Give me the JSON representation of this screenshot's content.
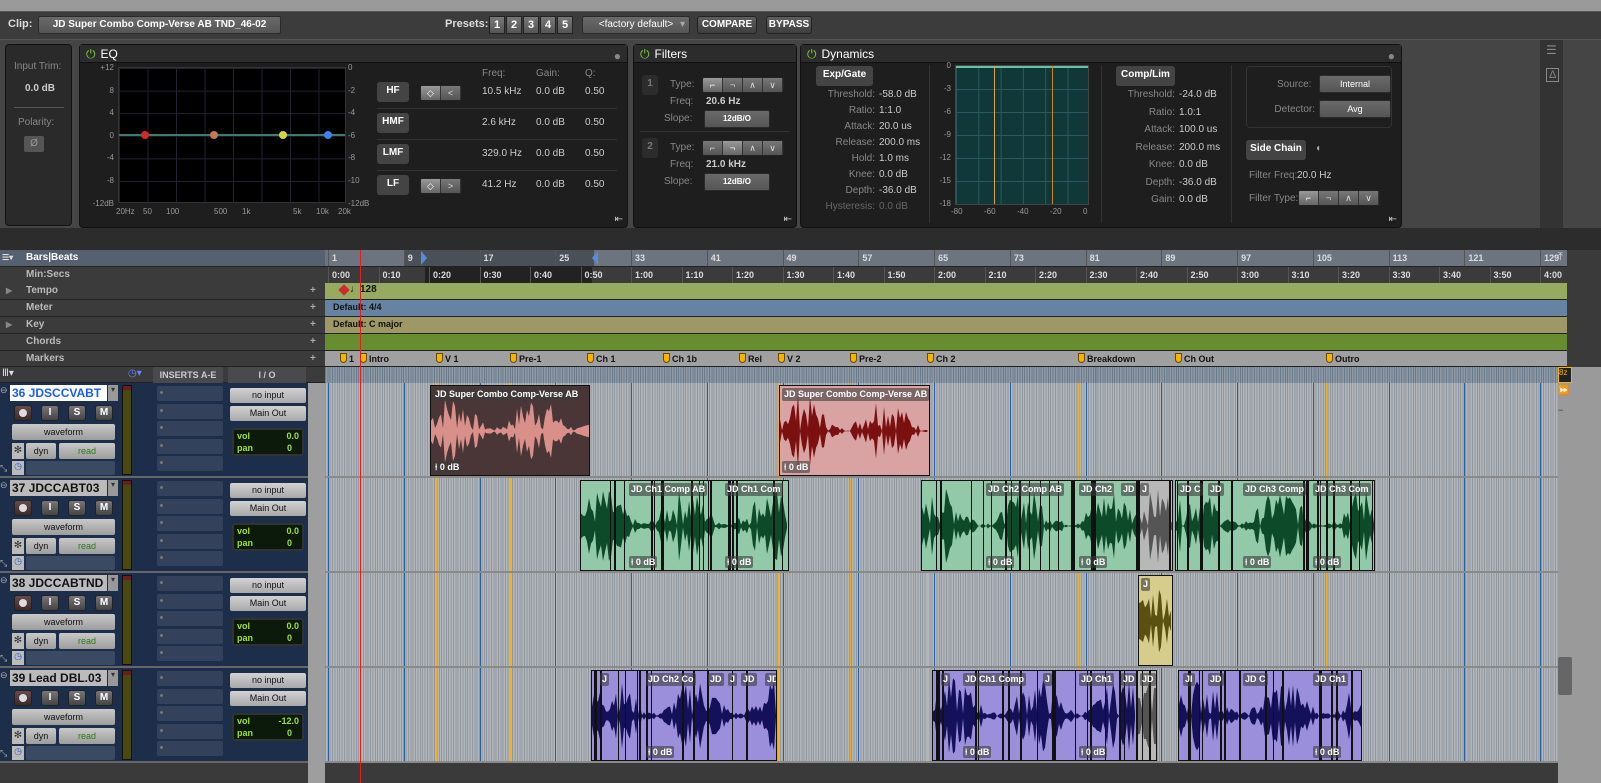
{
  "header": {
    "clip_label": "Clip:",
    "clip_name": "JD Super Combo Comp-Verse AB TND_46-02",
    "presets_label": "Presets:",
    "presets": [
      "1",
      "2",
      "3",
      "4",
      "5"
    ],
    "preset_dropdown": "<factory default>",
    "compare": "COMPARE",
    "bypass": "BYPASS"
  },
  "input": {
    "trim_label": "Input Trim:",
    "trim_value": "0.0 dB",
    "polarity_label": "Polarity:",
    "polarity_symbol": "Ø"
  },
  "eq": {
    "title": "EQ",
    "left_axis": [
      "+12",
      "8",
      "4",
      "0",
      "-4",
      "-8",
      "-12dB"
    ],
    "right_axis": [
      "0",
      "-2",
      "-4",
      "-6",
      "-8",
      "-10",
      "-12dB"
    ],
    "freq_axis": [
      "20Hz",
      "50",
      "100",
      "500",
      "1k",
      "5k",
      "10k",
      "20k"
    ],
    "col_headers": [
      "Freq:",
      "Gain:",
      "Q:"
    ],
    "bands": [
      {
        "name": "HF",
        "freq": "10.5 kHz",
        "gain": "0.0 dB",
        "q": "0.50",
        "color": "#3b82f6"
      },
      {
        "name": "HMF",
        "freq": "2.6 kHz",
        "gain": "0.0 dB",
        "q": "0.50",
        "color": "#d4d43a"
      },
      {
        "name": "LMF",
        "freq": "329.0 Hz",
        "gain": "0.0 dB",
        "q": "0.50",
        "color": "#c07a5a"
      },
      {
        "name": "LF",
        "freq": "41.2 Hz",
        "gain": "0.0 dB",
        "q": "0.50",
        "color": "#d02a2a"
      }
    ]
  },
  "filters": {
    "title": "Filters",
    "type_label": "Type:",
    "freq_label": "Freq:",
    "slope_label": "Slope:",
    "items": [
      {
        "num": "1",
        "freq": "20.6 Hz",
        "slope": "12dB/O"
      },
      {
        "num": "2",
        "freq": "21.0 kHz",
        "slope": "12dB/O"
      }
    ]
  },
  "dynamics": {
    "title": "Dynamics",
    "gate": {
      "title": "Exp/Gate",
      "rows": [
        [
          "Threshold:",
          "-58.0 dB"
        ],
        [
          "Ratio:",
          "1:1.0"
        ],
        [
          "Attack:",
          "20.0 us"
        ],
        [
          "Release:",
          "200.0 ms"
        ],
        [
          "Hold:",
          "1.0 ms"
        ],
        [
          "Knee:",
          "0.0 dB"
        ],
        [
          "Depth:",
          "-36.0 dB"
        ],
        [
          "Hysteresis:",
          "0.0 dB"
        ]
      ]
    },
    "graph": {
      "y_axis": [
        "0",
        "-3",
        "-6",
        "-9",
        "-12",
        "-15",
        "-18"
      ],
      "x_axis": [
        "-80",
        "-60",
        "-40",
        "-20",
        "0"
      ]
    },
    "comp": {
      "title": "Comp/Lim",
      "rows": [
        [
          "Threshold:",
          "-24.0 dB"
        ],
        [
          "Ratio:",
          "1.0:1"
        ],
        [
          "Attack:",
          "100.0 us"
        ],
        [
          "Release:",
          "200.0 ms"
        ],
        [
          "Knee:",
          "0.0 dB"
        ],
        [
          "Depth:",
          "-36.0 dB"
        ],
        [
          "Gain:",
          "0.0 dB"
        ]
      ]
    },
    "source_label": "Source:",
    "source_value": "Internal",
    "detector_label": "Detector:",
    "detector_value": "Avg",
    "side_chain": "Side Chain",
    "filter_freq_label": "Filter Freq:",
    "filter_freq_value": "20.0 Hz",
    "filter_type_label": "Filter Type:"
  },
  "rulers": {
    "bars_label": "Bars|Beats",
    "minsecs_label": "Min:Secs",
    "tempo_label": "Tempo",
    "meter_label": "Meter",
    "key_label": "Key",
    "chords_label": "Chords",
    "markers_label": "Markers",
    "bars": [
      "1",
      "9",
      "17",
      "25",
      "33",
      "41",
      "49",
      "57",
      "65",
      "73",
      "81",
      "89",
      "97",
      "105",
      "113",
      "121",
      "129"
    ],
    "times": [
      "0:00",
      "0:10",
      "0:20",
      "0:30",
      "0:40",
      "0:50",
      "1:00",
      "1:10",
      "1:20",
      "1:30",
      "1:40",
      "1:50",
      "2:00",
      "2:10",
      "2:20",
      "2:30",
      "2:40",
      "2:50",
      "3:00",
      "3:10",
      "3:20",
      "3:30",
      "3:40",
      "3:50",
      "4:00"
    ],
    "tempo_value": "128",
    "meter_value": "Default: 4/4",
    "key_value": "Default: C major",
    "markers": [
      "1",
      "Intro",
      "V 1",
      "Pre-1",
      "Ch 1",
      "Ch 1b",
      "Rel",
      "V 2",
      "Pre-2",
      "Ch 2",
      "Breakdown",
      "Ch Out",
      "Outro"
    ]
  },
  "track_header": {
    "inserts": "INSERTS A-E",
    "io": "I / O"
  },
  "tracks": [
    {
      "name": "36 JDSCCVABT",
      "input": "no input",
      "output": "Main Out",
      "view": "waveform",
      "dyn": "dyn",
      "auto": "read",
      "vol": "0.0",
      "pan": "0"
    },
    {
      "name": "37 JDCCABT03",
      "input": "no input",
      "output": "Main Out",
      "view": "waveform",
      "dyn": "dyn",
      "auto": "read",
      "vol": "0.0",
      "pan": "0"
    },
    {
      "name": "38 JDCCABTND",
      "input": "no input",
      "output": "Main Out",
      "view": "waveform",
      "dyn": "dyn",
      "auto": "read",
      "vol": "0.0",
      "pan": "0"
    },
    {
      "name": "39 Lead DBL.03",
      "input": "no input",
      "output": "Main Out",
      "view": "waveform",
      "dyn": "dyn",
      "auto": "read",
      "vol": "-12.0",
      "pan": "0"
    }
  ],
  "channel_buttons": [
    "I",
    "S",
    "M"
  ],
  "clip_gain": "0 dB",
  "clips": [
    [
      {
        "label": "JD Super Combo Comp-Verse AB",
        "gain": true
      },
      {
        "label": "JD Super Combo Comp-Verse AB",
        "gain": true
      }
    ],
    [
      {
        "label": "JD Ch1 Comp AB",
        "gain": true
      },
      {
        "label": "JD Ch1 Com",
        "gain": true
      },
      {
        "label": "JD Ch2 Comp AB",
        "gain": true
      },
      {
        "label": "JD Ch2",
        "gain": true
      },
      {
        "label": "JD",
        "gain": false
      },
      {
        "label": "J",
        "gain": false
      },
      {
        "label": "JD C",
        "gain": false
      },
      {
        "label": "JD",
        "gain": false
      },
      {
        "label": "JD Ch3 Comp",
        "gain": true
      },
      {
        "label": "JD Ch3 Com",
        "gain": true
      }
    ],
    [
      {
        "label": "J",
        "gain": false
      }
    ],
    [
      {
        "label": "J",
        "gain": false
      },
      {
        "label": "JD Ch2 Co",
        "gain": true
      },
      {
        "label": "JD",
        "gain": false
      },
      {
        "label": "J",
        "gain": false
      },
      {
        "label": "JD",
        "gain": false
      },
      {
        "label": "JD",
        "gain": false
      },
      {
        "label": "J",
        "gain": false
      },
      {
        "label": "JD Ch1 Comp",
        "gain": true
      },
      {
        "label": "J",
        "gain": false
      },
      {
        "label": "JD Ch1",
        "gain": true
      },
      {
        "label": "JD",
        "gain": false
      },
      {
        "label": "JD",
        "gain": false
      },
      {
        "label": "JI",
        "gain": false
      },
      {
        "label": "JD",
        "gain": false
      },
      {
        "label": "JD C",
        "gain": false
      },
      {
        "label": "JD Ch1",
        "gain": true
      }
    ]
  ],
  "colors": {
    "verse_dark": "#4a3636",
    "verse_pink": "#d9a3a3",
    "green": "#92c9a8",
    "green_wave": "#0d4a2a",
    "purple": "#9b8fdc",
    "purple_wave": "#14105a",
    "yellow": "#d6cc8c",
    "tempo": "#96aa60",
    "meter": "#6683a4",
    "key": "#9e9866",
    "chords": "#668e30",
    "markers": "#a0a0a0",
    "playhead": "#e02020"
  }
}
